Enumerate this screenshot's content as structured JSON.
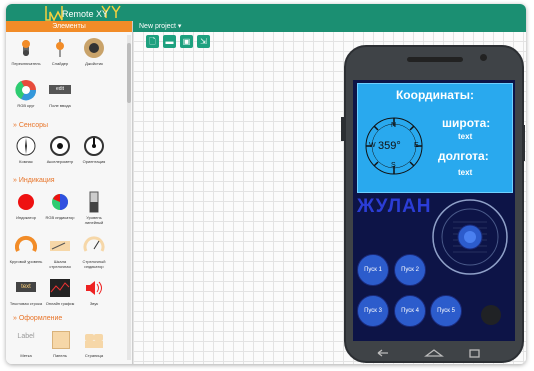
{
  "app": {
    "logo": "Remote XY"
  },
  "sidebar": {
    "header": "Элементы",
    "controls": [
      {
        "label": "Переключатель",
        "icon": "switch-icon"
      },
      {
        "label": "Слайдер",
        "icon": "slider-icon"
      },
      {
        "label": "Джойстик",
        "icon": "joystick-icon"
      },
      {
        "label": "RGB круг",
        "icon": "rgb-wheel-icon"
      },
      {
        "label": "Поле ввода",
        "icon": "edit-field-icon",
        "badge": "edit"
      }
    ],
    "sensors_title": "» Сенсоры",
    "sensors": [
      {
        "label": "Компас",
        "icon": "compass-icon"
      },
      {
        "label": "Акселерометр",
        "icon": "accelerometer-icon"
      },
      {
        "label": "Ориентация",
        "icon": "orientation-icon"
      }
    ],
    "indication_title": "» Индикация",
    "indication": [
      {
        "label": "Индикатор",
        "icon": "led-icon"
      },
      {
        "label": "RGB индикатор",
        "icon": "rgb-led-icon"
      },
      {
        "label": "Уровень линейный",
        "icon": "level-icon"
      },
      {
        "label": "Круговой уровень",
        "icon": "circular-level-icon"
      },
      {
        "label": "Шкала стрелочная",
        "icon": "scale-icon"
      },
      {
        "label": "Стрелочный индикатор",
        "icon": "needle-gauge-icon"
      },
      {
        "label": "Текстовая строка",
        "icon": "text-icon",
        "badge": "text"
      },
      {
        "label": "Онлайн график",
        "icon": "graph-icon"
      },
      {
        "label": "Звук",
        "icon": "sound-icon"
      }
    ],
    "decor_title": "» Оформление",
    "decor": [
      {
        "label": "Метка",
        "icon": "label-icon",
        "badge": "Label"
      },
      {
        "label": "Панель",
        "icon": "panel-icon"
      },
      {
        "label": "Страница",
        "icon": "page-icon"
      }
    ]
  },
  "project": {
    "tab_label": "New project ▾"
  },
  "toolbar": [
    {
      "name": "new-file-icon",
      "glyph": "🗋"
    },
    {
      "name": "open-folder-icon",
      "glyph": "▬"
    },
    {
      "name": "save-icon",
      "glyph": "▣"
    },
    {
      "name": "export-icon",
      "glyph": "⇲"
    }
  ],
  "phone": {
    "coords_title": "Координаты:",
    "compass_value": "359°",
    "compass_n": "N",
    "compass_s": "S",
    "compass_w": "W",
    "compass_e": "E",
    "lat_label": "широта:",
    "lat_value": "text",
    "lon_label": "долгота:",
    "lon_value": "text",
    "name": "ЖУЛАН",
    "buttons": [
      "Пуск 1",
      "Пуск 2",
      "Пуск 3",
      "Пуск 4",
      "Пуск 5"
    ]
  },
  "colors": {
    "brand": "#1b8f72",
    "accent": "#f28c28",
    "screen": "#0d1447",
    "panel": "#29a9ee"
  }
}
